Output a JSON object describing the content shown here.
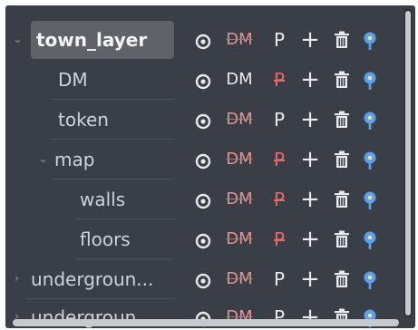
{
  "colors": {
    "panel_bg": "#3a3e47",
    "selected_bg": "#5f6369",
    "text": "#cfd3d9",
    "off_toggle": "#e79090",
    "pin": "#5aa0f0"
  },
  "icons": {
    "visibility": "eye-icon",
    "add": "plus-icon",
    "delete": "trash-icon",
    "pin": "pin-icon",
    "expand": "chevron-icon"
  },
  "tree": [
    {
      "label": "town_layer",
      "expander": "⌄",
      "dm": "DM",
      "dm_off": true,
      "p": "P",
      "p_off": false
    },
    {
      "label": "DM",
      "expander": "",
      "dm": "DM",
      "dm_off": false,
      "p": "P",
      "p_off": true
    },
    {
      "label": "token",
      "expander": "",
      "dm": "DM",
      "dm_off": true,
      "p": "P",
      "p_off": false
    },
    {
      "label": "map",
      "expander": "⌄",
      "dm": "DM",
      "dm_off": true,
      "p": "P",
      "p_off": true
    },
    {
      "label": "walls",
      "expander": "",
      "dm": "DM",
      "dm_off": true,
      "p": "P",
      "p_off": true
    },
    {
      "label": "floors",
      "expander": "",
      "dm": "DM",
      "dm_off": true,
      "p": "P",
      "p_off": true
    },
    {
      "label": "undergroun...",
      "expander": "›",
      "dm": "DM",
      "dm_off": true,
      "p": "P",
      "p_off": false
    },
    {
      "label": "undergroun...",
      "expander": "›",
      "dm": "DM",
      "dm_off": true,
      "p": "P",
      "p_off": false
    }
  ]
}
